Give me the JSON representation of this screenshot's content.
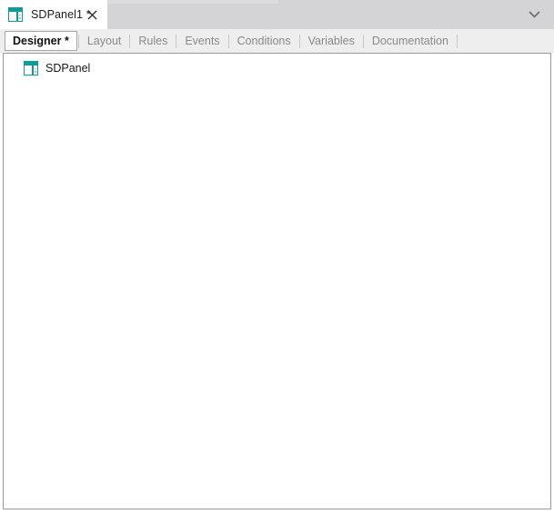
{
  "window": {
    "tab": {
      "icon": "panel-icon",
      "title": "SDPanel1 *",
      "close_icon": "close-icon"
    },
    "overflow_icon": "chevron-down-icon"
  },
  "section_tabs": [
    {
      "label": "Designer *",
      "active": true
    },
    {
      "label": "Layout",
      "active": false
    },
    {
      "label": "Rules",
      "active": false
    },
    {
      "label": "Events",
      "active": false
    },
    {
      "label": "Conditions",
      "active": false
    },
    {
      "label": "Variables",
      "active": false
    },
    {
      "label": "Documentation",
      "active": false
    }
  ],
  "designer": {
    "tree": [
      {
        "label": "SDPanel",
        "icon": "panel-icon"
      }
    ]
  },
  "colors": {
    "accent_teal": "#0f9b96",
    "tabbar_bg": "#d4d4d6",
    "section_strip_bg": "#eeeeee",
    "canvas_bg": "#ffffff",
    "canvas_border": "#9a9aa0",
    "inactive_tab_text": "#8a8a8a",
    "active_tab_text": "#111111"
  }
}
